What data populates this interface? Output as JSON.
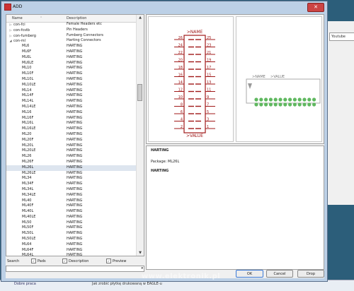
{
  "dialog": {
    "title": "ADD"
  },
  "list": {
    "headers": {
      "name": "Name",
      "description": "Description"
    },
    "rows": [
      {
        "expander": "▷",
        "name": "con-fci",
        "desc": "Female Headers etc"
      },
      {
        "expander": "▷",
        "name": "con-fcstb",
        "desc": "Pin Headers"
      },
      {
        "expander": "▷",
        "name": "con-fumberg",
        "desc": "Fumberg Connectors"
      },
      {
        "expander": "◢",
        "name": "con-ml",
        "desc": "Harting Connectors"
      },
      {
        "expander": "",
        "name": "ML6",
        "desc": "HARTING"
      },
      {
        "expander": "",
        "name": "ML6F",
        "desc": "HARTING"
      },
      {
        "expander": "",
        "name": "ML6L",
        "desc": "HARTING"
      },
      {
        "expander": "",
        "name": "ML6LE",
        "desc": "HARTING"
      },
      {
        "expander": "",
        "name": "ML10",
        "desc": "HARTING"
      },
      {
        "expander": "",
        "name": "ML10F",
        "desc": "HARTING"
      },
      {
        "expander": "",
        "name": "ML10L",
        "desc": "HARTING"
      },
      {
        "expander": "",
        "name": "ML10LE",
        "desc": "HARTING"
      },
      {
        "expander": "",
        "name": "ML14",
        "desc": "HARTING"
      },
      {
        "expander": "",
        "name": "ML14F",
        "desc": "HARTING"
      },
      {
        "expander": "",
        "name": "ML14L",
        "desc": "HARTING"
      },
      {
        "expander": "",
        "name": "ML14LE",
        "desc": "HARTING"
      },
      {
        "expander": "",
        "name": "ML16",
        "desc": "HARTING"
      },
      {
        "expander": "",
        "name": "ML16F",
        "desc": "HARTING"
      },
      {
        "expander": "",
        "name": "ML16L",
        "desc": "HARTING"
      },
      {
        "expander": "",
        "name": "ML16LE",
        "desc": "HARTING"
      },
      {
        "expander": "",
        "name": "ML20",
        "desc": "HARTING"
      },
      {
        "expander": "",
        "name": "ML20F",
        "desc": "HARTING"
      },
      {
        "expander": "",
        "name": "ML20L",
        "desc": "HARTING"
      },
      {
        "expander": "",
        "name": "ML20LE",
        "desc": "HARTING"
      },
      {
        "expander": "",
        "name": "ML26",
        "desc": "HARTING"
      },
      {
        "expander": "",
        "name": "ML26F",
        "desc": "HARTING"
      },
      {
        "expander": "",
        "name": "ML26L",
        "desc": "HARTING",
        "selected": true
      },
      {
        "expander": "",
        "name": "ML26LE",
        "desc": "HARTING"
      },
      {
        "expander": "",
        "name": "ML34",
        "desc": "HARTING"
      },
      {
        "expander": "",
        "name": "ML34F",
        "desc": "HARTING"
      },
      {
        "expander": "",
        "name": "ML34L",
        "desc": "HARTING"
      },
      {
        "expander": "",
        "name": "ML34LE",
        "desc": "HARTING"
      },
      {
        "expander": "",
        "name": "ML40",
        "desc": "HARTING"
      },
      {
        "expander": "",
        "name": "ML40F",
        "desc": "HARTING"
      },
      {
        "expander": "",
        "name": "ML40L",
        "desc": "HARTING"
      },
      {
        "expander": "",
        "name": "ML40LE",
        "desc": "HARTING"
      },
      {
        "expander": "",
        "name": "ML50",
        "desc": "HARTING"
      },
      {
        "expander": "",
        "name": "ML50F",
        "desc": "HARTING"
      },
      {
        "expander": "",
        "name": "ML50L",
        "desc": "HARTING"
      },
      {
        "expander": "",
        "name": "ML50LE",
        "desc": "HARTING"
      },
      {
        "expander": "",
        "name": "ML64",
        "desc": "HARTING"
      },
      {
        "expander": "",
        "name": "ML64F",
        "desc": "HARTING"
      },
      {
        "expander": "",
        "name": "ML64L",
        "desc": "HARTING"
      }
    ]
  },
  "symbol": {
    "name_label": ">NAME",
    "value_label": ">VALUE",
    "left_pins": [
      "26",
      "24",
      "22",
      "20",
      "18",
      "16",
      "14",
      "12",
      "10",
      "8",
      "6",
      "4",
      "2"
    ],
    "right_pins": [
      "25",
      "23",
      "21",
      "19",
      "17",
      "15",
      "13",
      "11",
      "9",
      "7",
      "5",
      "3",
      "1"
    ]
  },
  "package": {
    "name_label": ">NAME",
    "value_label": ">VALUE",
    "pin_count": 26
  },
  "description": {
    "title": "HARTING",
    "package_line": "Package: ML26L",
    "body": "HARTING"
  },
  "search": {
    "label": "Search",
    "opt_pads": "Pads",
    "opt_description": "Description",
    "opt_preview": "Preview",
    "value": ""
  },
  "buttons": {
    "ok": "OK",
    "cancel": "Cancel",
    "drop": "Drop"
  },
  "desktop": {
    "right_field": "Youtube",
    "taskbar_left": "Dobre praca",
    "taskbar_text": "Jak zrobić płytkę drukowaną w EAGLE-u"
  },
  "watermark": "www.elektronik.pl",
  "colors": {
    "symbol_red": "#a01818",
    "pad_green": "#5fb85f",
    "selection": "#dde5ef"
  }
}
